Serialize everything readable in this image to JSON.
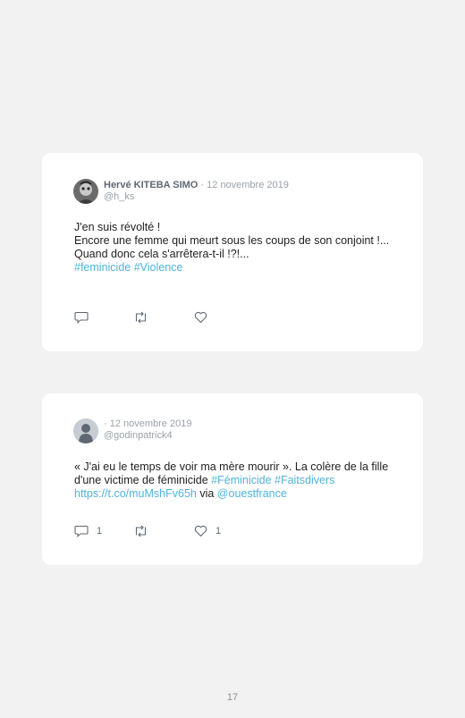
{
  "tweets": [
    {
      "author": "Hervé KITEBA SIMO",
      "date": "· 12 novembre 2019",
      "handle": "@h_ks",
      "lines": [
        "J'en suis révolté !",
        "Encore une femme qui meurt sous les coups de son conjoint !...",
        "Quand donc cela s'arrêtera-t-il !?!..."
      ],
      "hashtags": "#feminicide #Violence",
      "reply_count": "",
      "retweet_count": "",
      "like_count": ""
    },
    {
      "author": "",
      "date": "· 12 novembre 2019",
      "handle": "@godinpatrick4",
      "text": "« J'ai eu le temps de voir ma mère mourir ». La colère de la fille d'une victime de féminicide ",
      "hashtags": "#Féminicide #Faitsdivers",
      "url": "https://t.co/muMshFv65h",
      "via": " via ",
      "mention": "@ouestfrance",
      "reply_count": "1",
      "retweet_count": "",
      "like_count": "1"
    }
  ],
  "page_number": "17",
  "icons": {
    "reply": "reply-icon",
    "retweet": "retweet-icon",
    "like": "heart-icon"
  },
  "colors": {
    "link": "#4fb3dc",
    "background": "#f2f2f2",
    "card": "#ffffff"
  }
}
